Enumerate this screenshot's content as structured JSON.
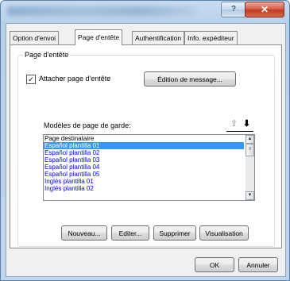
{
  "titlebar": {
    "help_label": "?",
    "close_label": "✕"
  },
  "tabs": [
    {
      "label": "Option d'envoi"
    },
    {
      "label": "Page d'entête"
    },
    {
      "label": "Authentification"
    },
    {
      "label": "Info. expéditeur"
    }
  ],
  "group": {
    "legend": "Page d'entête",
    "attach_label": "Attacher page d'entête",
    "attach_checked_mark": "✓",
    "edit_message_button": "Édition de message...",
    "list_label": "Modèles de page de garde:",
    "move_up_icon": "⇧",
    "move_down_icon": "⬇",
    "templates": [
      {
        "label": "Page destinataire",
        "style": "normal"
      },
      {
        "label": "Español plantilla 01",
        "style": "selected"
      },
      {
        "label": "Español plantilla 02",
        "style": "blue"
      },
      {
        "label": "Español plantilla 03",
        "style": "blue"
      },
      {
        "label": "Español plantilla 04",
        "style": "blue"
      },
      {
        "label": "Español plantilla 05",
        "style": "blue"
      },
      {
        "label": "Inglés plantilla 01",
        "style": "blue"
      },
      {
        "label": "Inglés plantilla 02",
        "style": "blue"
      }
    ],
    "buttons": {
      "new": "Nouveau...",
      "edit": "Editer...",
      "delete": "Supprimer",
      "preview": "Visualisation"
    }
  },
  "footer": {
    "ok": "OK",
    "cancel": "Annuler"
  },
  "colors": {
    "selection": "#3399ff",
    "template_text": "#0000ff"
  }
}
